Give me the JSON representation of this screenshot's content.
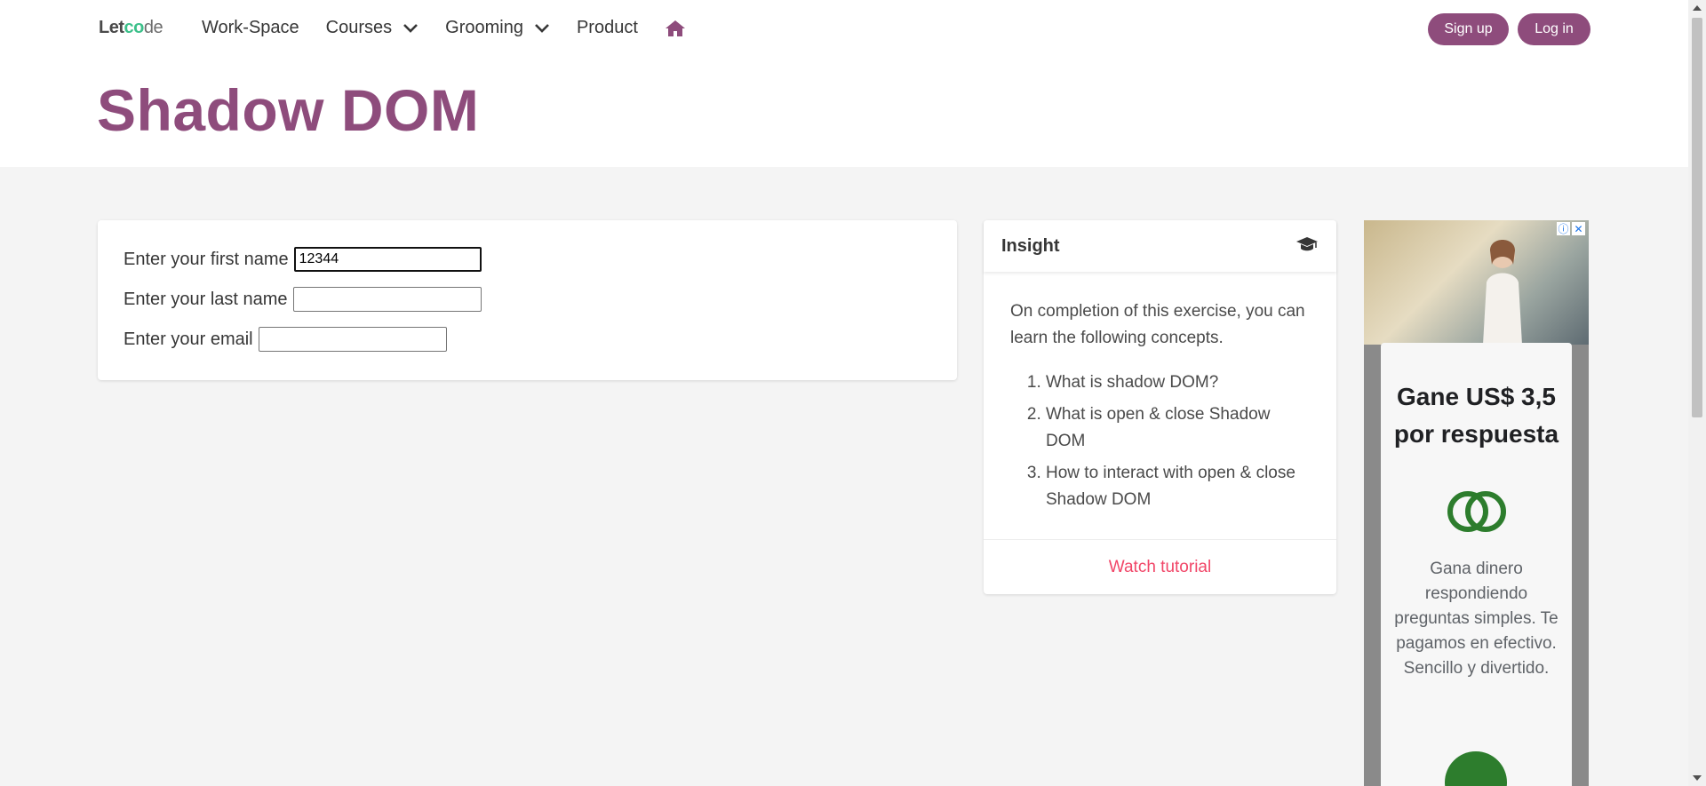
{
  "brand": {
    "logo_prefix": "Let",
    "logo_mark": "c",
    "logo_mid": "o",
    "logo_suffix": "de"
  },
  "nav": {
    "items": [
      {
        "label": "Work-Space"
      },
      {
        "label": "Courses"
      },
      {
        "label": "Grooming"
      },
      {
        "label": "Product"
      }
    ],
    "home_icon": "home-icon"
  },
  "auth": {
    "signup_label": "Sign up",
    "login_label": "Log in"
  },
  "colors": {
    "brand": "#8e4c7c",
    "link": "#f14668",
    "background": "#f4f4f4",
    "ad_green": "#2d7d2d"
  },
  "page": {
    "title": "Shadow DOM"
  },
  "form": {
    "first_name": {
      "label": "Enter your first name",
      "value": "12344"
    },
    "last_name": {
      "label": "Enter your last name",
      "value": ""
    },
    "email": {
      "label": "Enter your email",
      "value": ""
    }
  },
  "insight": {
    "title": "Insight",
    "icon": "graduation-cap-icon",
    "intro": "On completion of this exercise, you can learn the following concepts.",
    "concepts": [
      "What is shadow DOM?",
      "What is open & close Shadow DOM",
      "How to interact with open & close Shadow DOM"
    ],
    "tutorial_link": "Watch tutorial"
  },
  "ad": {
    "headline": "Gane US$ 3,5 por respuesta",
    "description": "Gana dinero respondiendo preguntas simples. Te pagamos en efectivo. Sencillo y divertido.",
    "info_icon": "info-icon",
    "close_icon": "close-icon"
  }
}
